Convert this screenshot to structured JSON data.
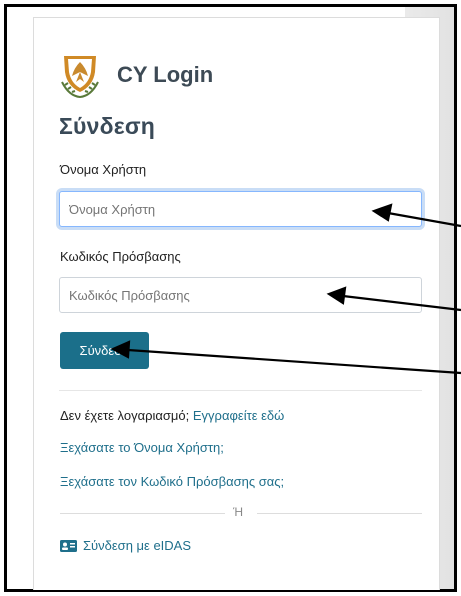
{
  "brand": {
    "title": "CY Login"
  },
  "form": {
    "heading": "Σύνδεση",
    "username_label": "Όνομα Χρήστη",
    "username_placeholder": "Όνομα Χρήστη",
    "password_label": "Κωδικός Πρόσβασης",
    "password_placeholder": "Κωδικός Πρόσβασης",
    "submit_label": "Σύνδεση"
  },
  "links": {
    "no_account_text": "Δεν έχετε λογαριασμό;",
    "register_link": "Εγγραφείτε εδώ",
    "forgot_username": "Ξεχάσατε το Όνομα Χρήστη;",
    "forgot_password": "Ξεχάσατε τον Κωδικό Πρόσβασης σας;"
  },
  "divider": {
    "or_text": "Ή"
  },
  "eidas": {
    "label": "Σύνδεση με eIDAS",
    "icon": "id-card-icon"
  },
  "colors": {
    "accent": "#1b6f8a",
    "link": "#1f6f8b",
    "heading": "#3a4a58",
    "focus_border": "#86b7fe"
  }
}
